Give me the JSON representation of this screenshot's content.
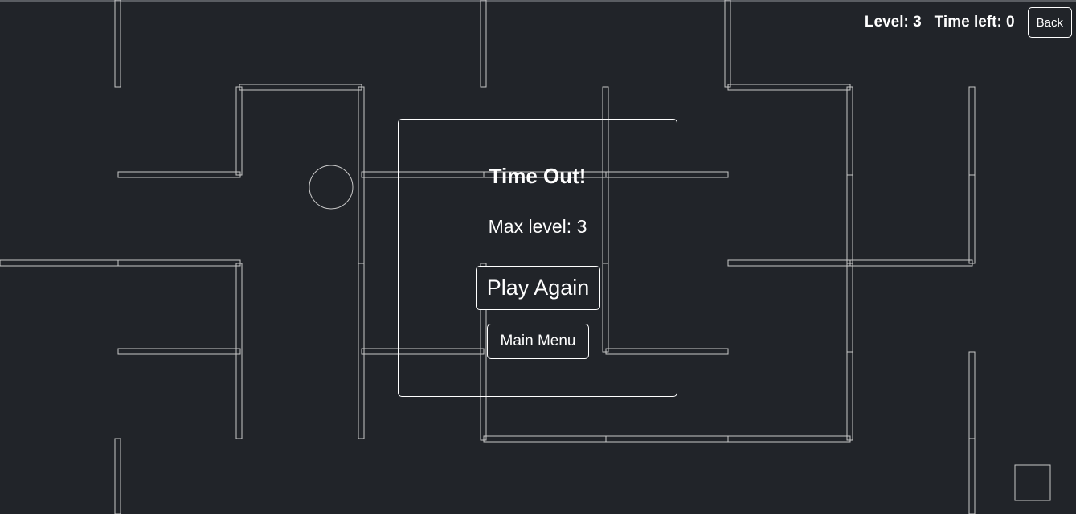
{
  "hud": {
    "level_label": "Level: 3",
    "time_label": "Time left: 0",
    "back_label": "Back"
  },
  "dialog": {
    "title": "Time Out!",
    "max_level_text": "Max level: 3",
    "play_again_label": "Play Again",
    "main_menu_label": "Main Menu"
  },
  "colors": {
    "background": "#212429",
    "wall_stroke": "#c8c8c8",
    "text": "#ffffff"
  }
}
